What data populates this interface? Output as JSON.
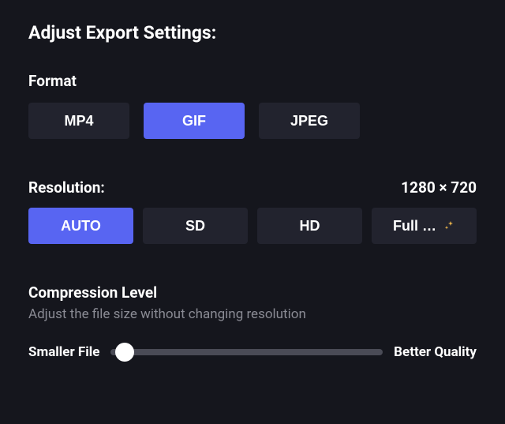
{
  "title": "Adjust Export Settings:",
  "format": {
    "label": "Format",
    "options": [
      "MP4",
      "GIF",
      "JPEG"
    ],
    "selected": "GIF"
  },
  "resolution": {
    "label": "Resolution:",
    "value": "1280 × 720",
    "options": [
      "AUTO",
      "SD",
      "HD",
      "Full …"
    ],
    "selected": "AUTO"
  },
  "compression": {
    "label": "Compression Level",
    "hint": "Adjust the file size without changing resolution",
    "left": "Smaller File",
    "right": "Better Quality"
  }
}
